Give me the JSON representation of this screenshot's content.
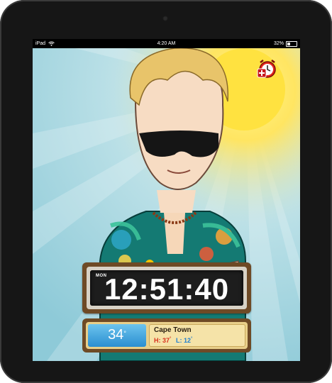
{
  "status_bar": {
    "device": "iPad",
    "time": "4:20 AM",
    "battery": "32%",
    "battery_level": 0.32
  },
  "clock": {
    "day": "MON",
    "time": "12:51:40"
  },
  "weather": {
    "temperature": "34",
    "temperature_unit": "°",
    "city": "Cape Town",
    "high_label": "H:",
    "high": "37",
    "low_label": "L:",
    "low": "12",
    "degree": "°"
  },
  "icons": {
    "alarm": "alarm-clock-icon",
    "wifi": "wifi-icon",
    "battery": "battery-icon"
  },
  "colors": {
    "sky": "#bfe2ea",
    "sun": "#ffe04a",
    "panel_frame": "#6e4a26",
    "weather_blue": "#2b8ed0",
    "high_red": "#d8301c",
    "low_blue": "#1f7fd0"
  }
}
